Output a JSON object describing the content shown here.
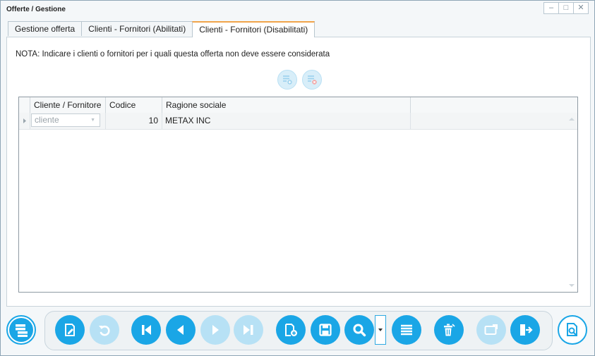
{
  "window": {
    "title": "Offerte / Gestione",
    "controls": [
      "–",
      "□",
      "✕"
    ]
  },
  "tabs": [
    {
      "label": "Gestione offerta",
      "active": false
    },
    {
      "label": "Clienti - Fornitori (Abilitati)",
      "active": false
    },
    {
      "label": "Clienti - Fornitori (Disabilitati)",
      "active": true
    }
  ],
  "note": "NOTA: Indicare i clienti o fornitori per i quali questa offerta non deve essere considerata",
  "panel_buttons": [
    {
      "icon": "add-list-icon"
    },
    {
      "icon": "remove-list-icon"
    }
  ],
  "grid": {
    "columns": [
      "Cliente / Fornitore",
      "Codice",
      "Ragione sociale"
    ],
    "rows": [
      {
        "tipo_placeholder": "cliente",
        "codice": "10",
        "ragione_sociale": "METAX INC"
      }
    ]
  },
  "toolbar": {
    "buttons": [
      {
        "name": "menu",
        "icon": "menu-grid-icon",
        "enabled": true
      },
      {
        "name": "edit",
        "icon": "edit-document-icon",
        "enabled": true
      },
      {
        "name": "undo",
        "icon": "undo-icon",
        "enabled": false
      },
      {
        "name": "first",
        "icon": "first-icon",
        "enabled": true
      },
      {
        "name": "previous",
        "icon": "previous-icon",
        "enabled": true
      },
      {
        "name": "next",
        "icon": "next-icon",
        "enabled": false
      },
      {
        "name": "last",
        "icon": "last-icon",
        "enabled": false
      },
      {
        "name": "new",
        "icon": "new-document-icon",
        "enabled": true
      },
      {
        "name": "save",
        "icon": "save-icon",
        "enabled": true
      },
      {
        "name": "search",
        "icon": "search-icon",
        "enabled": true
      },
      {
        "name": "list",
        "icon": "list-icon",
        "enabled": true
      },
      {
        "name": "delete",
        "icon": "delete-icon",
        "enabled": true
      },
      {
        "name": "transfer",
        "icon": "transfer-card-icon",
        "enabled": false
      },
      {
        "name": "exit",
        "icon": "exit-icon",
        "enabled": true
      },
      {
        "name": "preview",
        "icon": "document-search-icon",
        "enabled": true
      }
    ]
  },
  "colors": {
    "accent": "#1aa6e6",
    "accent_disabled": "#b7e1f5",
    "active_tab_border": "#f0a44a"
  }
}
